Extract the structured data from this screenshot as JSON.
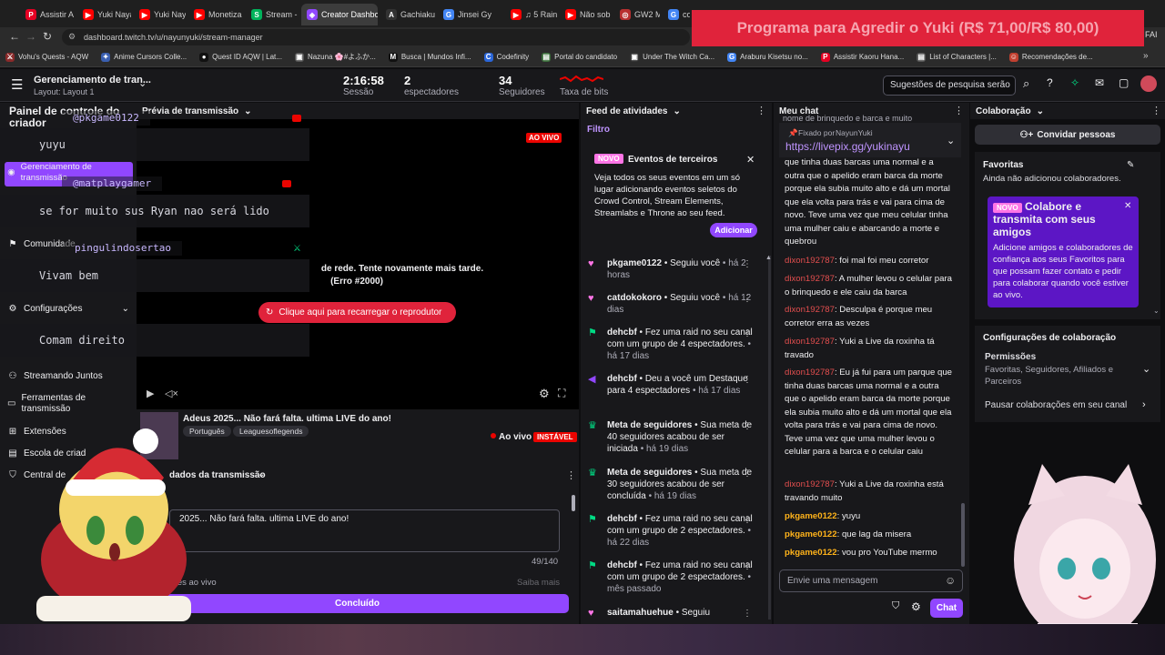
{
  "browser": {
    "tabs": [
      {
        "label": "Assistir A",
        "icon": "P",
        "color": "#e60023"
      },
      {
        "label": "Yuki Naya",
        "icon": "▶",
        "color": "#ff0000"
      },
      {
        "label": "Yuki Naya",
        "icon": "▶",
        "color": "#ff0000"
      },
      {
        "label": "Monetiza",
        "icon": "▶",
        "color": "#ff0000"
      },
      {
        "label": "Stream -",
        "icon": "S",
        "color": "#00b25b"
      },
      {
        "label": "Creator Dashboa",
        "icon": "◈",
        "color": "#9147ff"
      },
      {
        "label": "Gachiaku",
        "icon": "A",
        "color": "#333"
      },
      {
        "label": "Jinsei Gy",
        "icon": "G",
        "color": "#4285f4"
      },
      {
        "label": "♫ 5 Raini",
        "icon": "▶",
        "color": "#ff0000"
      },
      {
        "label": "Não sob",
        "icon": "▶",
        "color": "#ff0000"
      },
      {
        "label": "GW2 Ma",
        "icon": "◎",
        "color": "#b83030"
      },
      {
        "label": "com",
        "icon": "G",
        "color": "#4285f4"
      }
    ],
    "url": "dashboard.twitch.tv/u/nayunyuki/stream-manager",
    "bookmarks": [
      {
        "label": "Vohu's Quests - AQW",
        "icon": "⚔",
        "color": "#8a2a2a"
      },
      {
        "label": "Anime Cursors Colle...",
        "icon": "✦",
        "color": "#3a5fb0"
      },
      {
        "label": "Quest ID AQW | Lat...",
        "icon": "●",
        "color": "#111"
      },
      {
        "label": "Nazuna 🌸#よふか...",
        "icon": "▣",
        "color": "#555"
      },
      {
        "label": "Busca | Mundos Infi...",
        "icon": "M",
        "color": "#111"
      },
      {
        "label": "Codefinity",
        "icon": "C",
        "color": "#2a66d9"
      },
      {
        "label": "Portal do candidato",
        "icon": "▤",
        "color": "#3b6e3b"
      },
      {
        "label": "Under The Witch Ca...",
        "icon": "▣",
        "color": "#333"
      },
      {
        "label": "Araburu Kisetsu no...",
        "icon": "G",
        "color": "#4285f4"
      },
      {
        "label": "Assistir Kaoru Hana...",
        "icon": "P",
        "color": "#e60023"
      },
      {
        "label": "List of Characters |...",
        "icon": "▤",
        "color": "#555"
      },
      {
        "label": "Recomendações de...",
        "icon": "☺",
        "color": "#c04030"
      }
    ],
    "right_label": "FAI"
  },
  "overlay_banner": "Programa para Agredir o Yuki (R$ 71,00/R$ 80,00)",
  "header": {
    "title": "Gerenciamento de tran...",
    "subtitle": "Layout: Layout 1",
    "session_value": "2:16:58",
    "session_label": "Sessão",
    "viewers_value": "2",
    "viewers_label": "espectadores",
    "followers_value": "34",
    "followers_label": "Seguidores",
    "bits_label": "Taxa de bits",
    "search_placeholder": "Sugestões de pesquisa serão"
  },
  "sidebar": {
    "title": "Painel de controle do criador",
    "items": [
      {
        "label": "Gerenciamento de transmissão",
        "icon": "radio-icon"
      },
      {
        "label": "Comunidade",
        "icon": "community-icon"
      },
      {
        "label": "Configurações",
        "icon": "gear-icon"
      },
      {
        "label": "Streamando Juntos",
        "icon": "people-icon"
      },
      {
        "label": "Ferramentas de transmissão",
        "icon": "tools-icon"
      },
      {
        "label": "Extensões",
        "icon": "extensions-icon"
      },
      {
        "label": "Escola de criad",
        "icon": "school-icon"
      },
      {
        "label": "Central de",
        "icon": "shield-icon"
      }
    ]
  },
  "preview": {
    "header": "Prévia de transmissão",
    "live_badge": "AO VIVO",
    "error_text_1": "de rede. Tente novamente mais tarde.",
    "error_text_2": "(Erro #2000)",
    "reload_button": "Clique aqui para recarregar o reprodutor",
    "stream_title": "Adeus 2025... Não fará falta. ultima LIVE do ano!",
    "tags": [
      "Português",
      "Leaguesoflegends"
    ],
    "status": "Ao vivo",
    "health": "INSTÁVEL"
  },
  "stream_info": {
    "header": "dados da transmissão",
    "title_value": "2025... Não fará falta. ultima LIVE do ano!",
    "char_count": "49/140",
    "notifications": "otificações ao vivo",
    "learn_more": "Saiba mais",
    "done_button": "Concluído"
  },
  "overlay_chat": [
    {
      "name": "@pkgame0122",
      "msg": "yuyu"
    },
    {
      "name": "@matplaygamer",
      "msg": "se for muito sus Ryan nao será lido"
    },
    {
      "name": "pingulindosertao",
      "msg": "Vivam bem"
    },
    {
      "name": "",
      "msg": "Comam direito"
    }
  ],
  "activity": {
    "header": "Feed de atividades",
    "filter": "Filtro",
    "card": {
      "badge": "NOVO",
      "title": "Eventos de terceiros",
      "body": "Veja todos os seus eventos em um só lugar adicionando eventos seletos do Crowd Control, Stream Elements, Streamlabs e Throne ao seu feed.",
      "button": "Adicionar"
    },
    "items": [
      {
        "icon": "heart-icon",
        "user": "pkgame0122",
        "action": " • Seguiu você",
        "time": "há 2 horas"
      },
      {
        "icon": "heart-icon",
        "user": "catdokokoro",
        "action": " • Seguiu você",
        "time": "há 12 dias"
      },
      {
        "icon": "raid-icon",
        "user": "dehcbf",
        "action": " • Fez uma raid no seu canal com um grupo de 4 espectadores.",
        "time": "há 17 dias"
      },
      {
        "icon": "megaphone-icon",
        "user": "dehcbf",
        "action": " • Deu a você um Destaque para 4 espectadores",
        "time": "há 17 dias"
      },
      {
        "icon": "trophy-icon",
        "user": "Meta de seguidores",
        "action": " • Sua meta de 40 seguidores acabou de ser iniciada",
        "time": "há 19 dias"
      },
      {
        "icon": "trophy-icon",
        "user": "Meta de seguidores",
        "action": " • Sua meta de 30 seguidores acabou de ser concluída",
        "time": "há 19 dias"
      },
      {
        "icon": "raid-icon",
        "user": "dehcbf",
        "action": " • Fez uma raid no seu canal com um grupo de 2 espectadores.",
        "time": "há 22 dias"
      },
      {
        "icon": "raid-icon",
        "user": "dehcbf",
        "action": " • Fez uma raid no seu canal com um grupo de 2 espectadores.",
        "time": "mês passado"
      },
      {
        "icon": "heart-icon",
        "user": "saitamahuehue",
        "action": " • Seguiu",
        "time": ""
      }
    ]
  },
  "chat": {
    "header": "Meu chat",
    "partial_top": "nome de brinquedo e barca e muito",
    "pinned_by": "Fixado por",
    "pinned_user": "NayunYuki",
    "pinned_link": "https://livepix.gg/yukinayu",
    "messages": [
      {
        "user": "",
        "text": "que tinha duas barcas uma normal e a outra que o apelido eram barca da morte porque ela subia muito alto e dá um mortal que ela volta para trás e vai para cima de novo. Teve uma vez que meu celular tinha uma mulher caiu e abarcando a morte e quebrou",
        "color": "none"
      },
      {
        "user": "dixon192787",
        "text": ": foi mal foi meu corretor",
        "color": "r"
      },
      {
        "user": "dixon192787",
        "text": ": A mulher levou o celular para o brinquedo e ele caiu da barca",
        "color": "r"
      },
      {
        "user": "dixon192787",
        "text": ": Desculpa é porque meu corretor erra as vezes",
        "color": "r"
      },
      {
        "user": "dixon192787",
        "text": ": Yuki a Live da roxinha tá travado",
        "color": "r"
      },
      {
        "user": "dixon192787",
        "text": ": Eu já fui para um parque que tinha duas barcas uma normal e a outra que o apelido eram barca da morte porque ela subia muito alto e dá um mortal que ela volta para trás e vai para cima de novo. Teve uma vez que uma mulher levou o celular para a barca e o celular caiu",
        "color": "r"
      },
      {
        "user": "dixon192787",
        "text": ": Yuki a Live da roxinha está travando muito",
        "color": "r"
      },
      {
        "user": "pkgame0122",
        "text": ": yuyu",
        "color": "y"
      },
      {
        "user": "pkgame0122",
        "text": ": que lag da misera",
        "color": "y"
      },
      {
        "user": "pkgame0122",
        "text": ": vou pro YouTube mermo",
        "color": "y"
      }
    ],
    "input_placeholder": "Envie uma mensagem",
    "send_button": "Chat"
  },
  "collab": {
    "header": "Colaboração",
    "invite_button": "Convidar pessoas",
    "favorites_title": "Favoritas",
    "favorites_empty": "Ainda não adicionou colaboradores.",
    "promo_badge": "NOVO",
    "promo_title": "Colabore e transmita com seus amigos",
    "promo_body": "Adicione amigos e colaboradores de confiança aos seus Favoritos para que possam fazer contato e pedir para colaborar quando você estiver ao vivo.",
    "settings_title": "Configurações de colaboração",
    "permissions_label": "Permissões",
    "permissions_value": "Favoritas, Seguidores, Afiliados e Parceiros",
    "pause_label": "Pausar colaborações em seu canal"
  },
  "colors": {
    "accent": "#9147ff",
    "live": "#eb0400",
    "banner": "#e0233b"
  }
}
